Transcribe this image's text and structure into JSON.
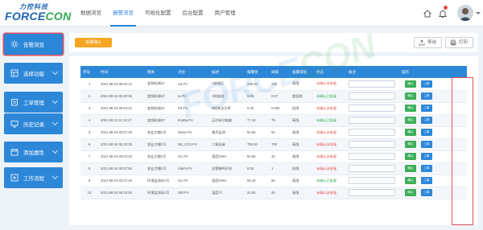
{
  "header": {
    "logo_cn": "力控科技",
    "logo_en_a": "FORCE",
    "logo_en_b": "CON",
    "nav": [
      "数据浏览",
      "报警浏览",
      "可视化配置",
      "后台配置",
      "用户管理"
    ],
    "active_nav": 1
  },
  "sidebar": {
    "items": [
      {
        "label": "告警浏览",
        "icon": "sun-icon",
        "active": true
      },
      {
        "label": "选择功能",
        "icon": "grid-icon",
        "active": false
      },
      {
        "label": "工单管理",
        "icon": "clipboard-icon",
        "active": false
      },
      {
        "label": "历史记录",
        "icon": "monitor-icon",
        "active": false
      },
      {
        "label": "添加属性",
        "icon": "calendar-icon",
        "active": false
      },
      {
        "label": "工作流程",
        "icon": "workflow-icon",
        "active": false
      }
    ]
  },
  "toolbar": {
    "batch_label": "批量确认",
    "export_label": "导出",
    "print_label": "打印"
  },
  "table": {
    "headers": [
      "序号",
      "时间",
      "网关",
      "点位",
      "描述",
      "报警值",
      "阈值",
      "报警等级",
      "状态",
      "备注",
      "操作"
    ],
    "rows": [
      [
        "1",
        "2021-08-24 05:52:14",
        "变频机械1#",
        "Ua.PV",
        "A相电压",
        "238.20",
        "235",
        "高限",
        "未确认未恢复"
      ],
      [
        "2",
        "2021-08-23 05:20:39",
        "变频机械1#",
        "Ia.PV",
        "A相电流",
        "0.05",
        "0.07",
        "超低限",
        "未确认已恢复"
      ],
      [
        "3",
        "2021-08-24 00:54:24",
        "变频机械1#",
        "Pb.PV",
        "B相有功功率",
        "0.00",
        "0.000",
        "低限",
        "未确认未恢复"
      ],
      [
        "4",
        "2021-08-12 11:10:17",
        "变频机械2#",
        "ImpEp.PV",
        "正向有功电能",
        "77.10",
        "75",
        "高限",
        "未确认已恢复"
      ],
      [
        "5",
        "2021-08-24 00:57:38",
        "农业大棚1号",
        "Noise.PV",
        "噪声监测",
        "50.60",
        "50",
        "高限",
        "未确认未恢复"
      ],
      [
        "6",
        "2021-08-24 05:20:35",
        "农业大棚1号",
        "ND_CO2.PV",
        "二氧化碳",
        "705.00",
        "700",
        "高限",
        "未确认未恢复"
      ],
      [
        "7",
        "2021-08-24 06:03:34",
        "农业大棚1号",
        "SC.PV",
        "湿度%RH",
        "50.60",
        "40",
        "高限",
        "未确认未恢复"
      ],
      [
        "8",
        "2021-08-24 00:57:50",
        "农业大棚1号",
        "Alarm.PV",
        "告警蜂鸣开关",
        "0.00",
        "1",
        "低限",
        "未确认未恢复"
      ],
      [
        "9",
        "2021-08-23 03:47:48",
        "环境监测站1号",
        "SC.PV",
        "湿度%RH",
        "65.10",
        "65",
        "高限",
        "未确认已恢复"
      ],
      [
        "10",
        "2021-08-24 06:15:30",
        "环境监测站1号",
        "WD.PV",
        "温度℃",
        "24.90",
        "25",
        "高限",
        "未确认未恢复"
      ]
    ],
    "confirm_label": "确认",
    "order_label": "工单"
  },
  "watermark": {
    "a": "FORCE",
    "b": "CON"
  },
  "colors": {
    "primary": "#2d87d8",
    "orange": "#f5a623",
    "green": "#3dae5a",
    "alert": "#e84c4c",
    "highlight": "#e0505e"
  }
}
